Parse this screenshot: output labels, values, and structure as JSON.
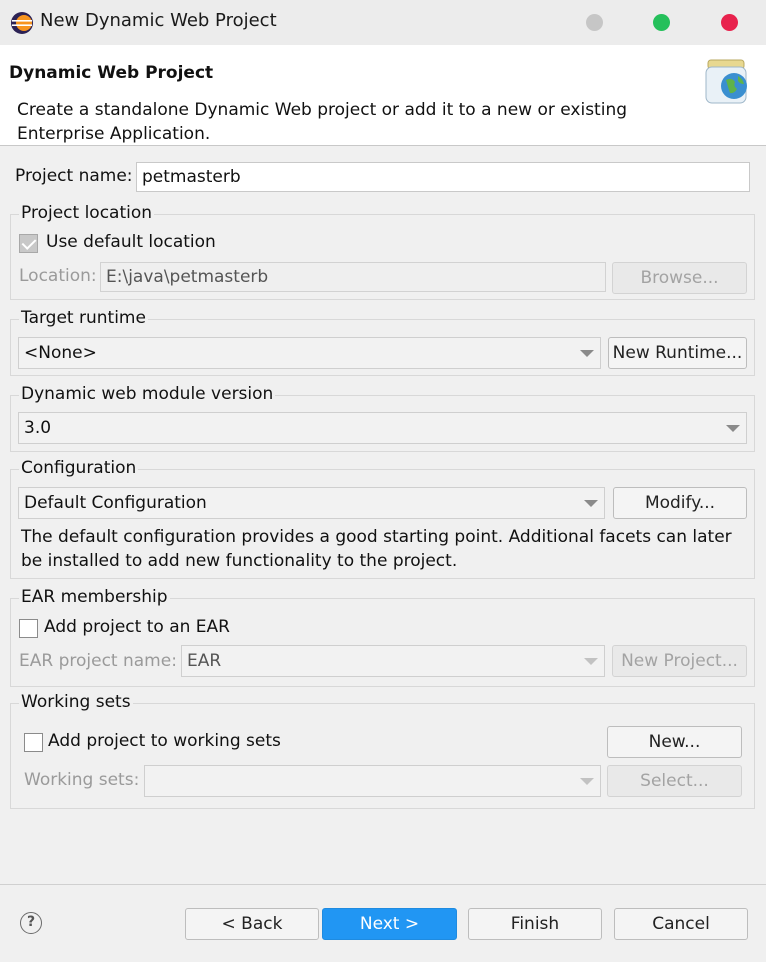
{
  "window": {
    "title": "New Dynamic Web Project"
  },
  "header": {
    "title": "Dynamic Web Project",
    "description": "Create a standalone Dynamic Web project or add it to a new or existing Enterprise Application."
  },
  "project_name": {
    "label": "Project name:",
    "value": "petmasterb"
  },
  "project_location": {
    "group_label": "Project location",
    "use_default_label": "Use default location",
    "use_default_checked": true,
    "location_label": "Location:",
    "location_value": "E:\\java\\petmasterb",
    "browse_label": "Browse..."
  },
  "target_runtime": {
    "group_label": "Target runtime",
    "selected": "<None>",
    "new_runtime_label": "New Runtime..."
  },
  "module_version": {
    "group_label": "Dynamic web module version",
    "selected": "3.0"
  },
  "configuration": {
    "group_label": "Configuration",
    "selected": "Default Configuration",
    "modify_label": "Modify...",
    "description": "The default configuration provides a good starting point. Additional facets can later be installed to add new functionality to the project."
  },
  "ear_membership": {
    "group_label": "EAR membership",
    "add_label": "Add project to an EAR",
    "add_checked": false,
    "ear_name_label": "EAR project name:",
    "ear_name_value": "EAR",
    "new_project_label": "New Project..."
  },
  "working_sets": {
    "group_label": "Working sets",
    "add_label": "Add project to working sets",
    "add_checked": false,
    "new_label": "New...",
    "sets_label": "Working sets:",
    "sets_value": "",
    "select_label": "Select..."
  },
  "footer": {
    "help_glyph": "?",
    "back_label": "< Back",
    "next_label": "Next >",
    "finish_label": "Finish",
    "cancel_label": "Cancel"
  },
  "colors": {
    "accent": "#2196f3",
    "traffic_close": "#e8224d",
    "traffic_max": "#25c05b",
    "traffic_min": "#c6c6c6"
  }
}
